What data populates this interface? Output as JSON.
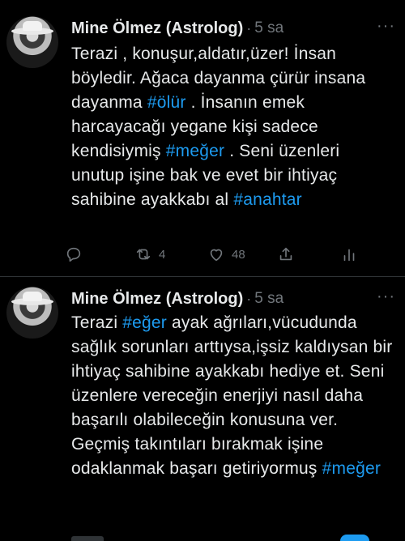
{
  "tweets": [
    {
      "author": "Mine Ölmez (Astrolog)",
      "separator": "·",
      "time": "5 sa",
      "more": "···",
      "segments": [
        {
          "t": "Terazi , konuşur,aldatır,üzer! İnsan böyledir. Ağaca dayanma çürür insana dayanma "
        },
        {
          "t": "#ölür",
          "tag": true
        },
        {
          "t": " . İnsanın emek harcayacağı yegane kişi sadece kendisiymiş "
        },
        {
          "t": "#meğer",
          "tag": true
        },
        {
          "t": " . Seni üzenleri unutup işine bak ve evet bir ihtiyaç sahibine ayakkabı al "
        },
        {
          "t": "#anahtar",
          "tag": true
        }
      ],
      "actions": {
        "reply_icon": "reply-icon",
        "retweets": "4",
        "likes": "48",
        "share_icon": "share-icon",
        "stats_icon": "stats-icon"
      }
    },
    {
      "author": "Mine Ölmez (Astrolog)",
      "separator": "·",
      "time": "5 sa",
      "more": "···",
      "segments": [
        {
          "t": "Terazi "
        },
        {
          "t": "#eğer",
          "tag": true
        },
        {
          "t": " ayak ağrıları,vücudunda sağlık sorunları arttıysa,işsiz kaldıysan bir ihtiyaç sahibine ayakkabı hediye et. Seni üzenlere vereceğin enerjiyi nasıl daha başarılı olabileceğin konusuna ver. Geçmiş takıntıları bırakmak işine odaklanmak başarı getiriyormuş "
        },
        {
          "t": "#meğer",
          "tag": true
        }
      ]
    }
  ],
  "colors": {
    "link": "#1d9bf0",
    "muted": "#71767b",
    "text": "#e7e9ea",
    "background": "#000000"
  }
}
